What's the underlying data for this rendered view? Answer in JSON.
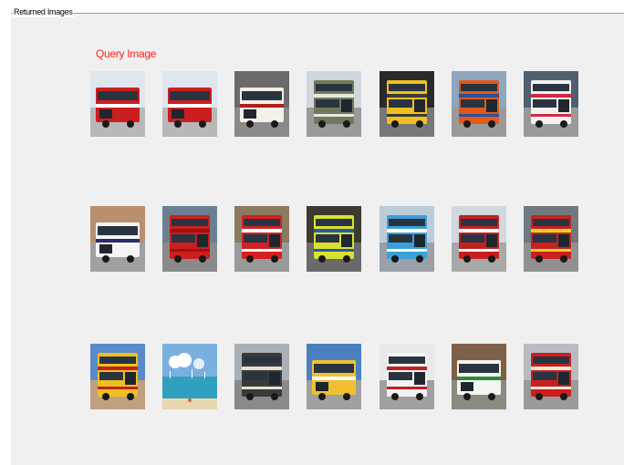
{
  "panel": {
    "title": "Returned Images"
  },
  "query_label": "Query Image",
  "grid": {
    "rows": [
      [
        {
          "kind": "bus",
          "sky": "#dfe6ee",
          "ground": "#b8b8b8",
          "body": "#cc1e1e",
          "band": "#ffffff",
          "deck": "single"
        },
        {
          "kind": "bus",
          "sky": "#dfe6ee",
          "ground": "#b8b8b8",
          "body": "#cc1e1e",
          "band": "#ffffff",
          "deck": "single"
        },
        {
          "kind": "bus",
          "sky": "#6b6b6b",
          "ground": "#8a8a8a",
          "body": "#f4f0ea",
          "band": "#b31c1c",
          "deck": "single"
        },
        {
          "kind": "bus",
          "sky": "#cfd6dc",
          "ground": "#9a9a9a",
          "body": "#6f7a5a",
          "band": "#e8e8e0",
          "deck": "double"
        },
        {
          "kind": "bus",
          "sky": "#2a2a2a",
          "ground": "#777777",
          "body": "#f0c020",
          "band": "#3a3a3a",
          "deck": "double"
        },
        {
          "kind": "bus",
          "sky": "#8ea6c0",
          "ground": "#9a9a9a",
          "body": "#e05a1a",
          "band": "#2a4fa0",
          "deck": "double"
        },
        {
          "kind": "bus",
          "sky": "#506070",
          "ground": "#999999",
          "body": "#f2f2f2",
          "band": "#d02a40",
          "deck": "double"
        }
      ],
      [
        {
          "kind": "bus",
          "sky": "#b89070",
          "ground": "#a0a0a0",
          "body": "#f4f4f4",
          "band": "#2a2a6a",
          "deck": "single"
        },
        {
          "kind": "bus",
          "sky": "#6a8090",
          "ground": "#8a8a8a",
          "body": "#cc1e1e",
          "band": "#a01010",
          "deck": "double"
        },
        {
          "kind": "bus",
          "sky": "#8a7a60",
          "ground": "#9a9a9a",
          "body": "#d42020",
          "band": "#ffffff",
          "deck": "double"
        },
        {
          "kind": "bus",
          "sky": "#3a3a30",
          "ground": "#6a6a6a",
          "body": "#d8e030",
          "band": "#2a5aa0",
          "deck": "double"
        },
        {
          "kind": "bus",
          "sky": "#bcccda",
          "ground": "#9aa0a8",
          "body": "#3aa0d8",
          "band": "#ffffff",
          "deck": "double"
        },
        {
          "kind": "bus",
          "sky": "#d0d8e0",
          "ground": "#a8a8a8",
          "body": "#c81e1e",
          "band": "#ffffff",
          "deck": "double"
        },
        {
          "kind": "bus",
          "sky": "#707880",
          "ground": "#909090",
          "body": "#c82020",
          "band": "#f0d020",
          "deck": "double"
        }
      ],
      [
        {
          "kind": "bus",
          "sky": "#5a8ac8",
          "ground": "#c0a080",
          "body": "#f0c020",
          "band": "#c02020",
          "deck": "double"
        },
        {
          "kind": "beach",
          "sky": "#7ab0e0",
          "ground": "#30a0c0",
          "body": "#e8d8b0",
          "band": "#ffffff",
          "deck": "none"
        },
        {
          "kind": "bus",
          "sky": "#a8b0b8",
          "ground": "#8a8a8a",
          "body": "#3a3a3a",
          "band": "#e8e0d0",
          "deck": "double"
        },
        {
          "kind": "bus",
          "sky": "#4a80c0",
          "ground": "#a0a0a0",
          "body": "#f0c030",
          "band": "#ffffff",
          "deck": "single"
        },
        {
          "kind": "bus",
          "sky": "#e8e8e8",
          "ground": "#a0a0a0",
          "body": "#f2f2f2",
          "band": "#c02020",
          "deck": "double"
        },
        {
          "kind": "bus",
          "sky": "#806048",
          "ground": "#8a8a80",
          "body": "#f4f4f0",
          "band": "#2a8a3a",
          "deck": "single"
        },
        {
          "kind": "bus",
          "sky": "#b8bcc0",
          "ground": "#9a9a9a",
          "body": "#cc1e1e",
          "band": "#f0e8d0",
          "deck": "double"
        }
      ]
    ]
  }
}
